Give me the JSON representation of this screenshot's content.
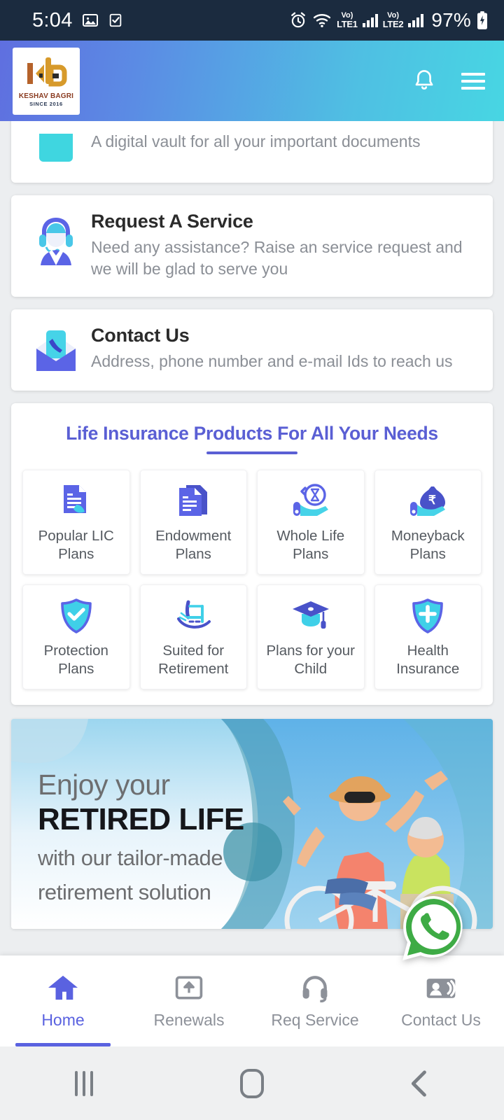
{
  "status_bar": {
    "time": "5:04",
    "battery_percent": "97%",
    "icons": [
      "image-icon",
      "checkbox-icon",
      "alarm-icon",
      "wifi-icon",
      "volte-lte1-icon",
      "signal-lte1-icon",
      "volte-lte2-icon",
      "signal-lte2-icon",
      "battery-charging-icon"
    ],
    "network_labels": {
      "volte": "Vo)",
      "sim1": "LTE1",
      "sim2": "LTE2"
    },
    "background": "#1b2b3f"
  },
  "app_bar": {
    "logo": {
      "name": "KESHAV BAGRI",
      "since": "SINCE 2016"
    },
    "notification_icon": "bell-icon",
    "menu_icon": "hamburger-menu-icon",
    "gradient_from": "#5f6fe0",
    "gradient_to": "#47d6e3"
  },
  "cards": [
    {
      "icon": "digital-vault-icon",
      "title": "",
      "desc": "A digital vault for all your important documents"
    },
    {
      "icon": "support-agent-icon",
      "title": "Request A Service",
      "desc": "Need any assistance? Raise an service request and we will be glad to serve you"
    },
    {
      "icon": "contact-envelope-icon",
      "title": "Contact Us",
      "desc": "Address, phone number and e-mail Ids to reach us"
    }
  ],
  "products": {
    "heading": "Life Insurance Products For All Your Needs",
    "accent_color": "#5a5fd4",
    "tiles": [
      {
        "icon": "document-star-icon",
        "label": "Popular LIC Plans"
      },
      {
        "icon": "documents-stack-icon",
        "label": "Endowment Plans"
      },
      {
        "icon": "hourglass-hand-icon",
        "label": "Whole Life Plans"
      },
      {
        "icon": "money-bag-hand-icon",
        "label": "Moneyback Plans"
      },
      {
        "icon": "shield-check-icon",
        "label": "Protection Plans"
      },
      {
        "icon": "rocking-chair-icon",
        "label": "Suited for Retirement"
      },
      {
        "icon": "graduation-cap-icon",
        "label": "Plans for your Child"
      },
      {
        "icon": "shield-plus-icon",
        "label": "Health Insurance"
      }
    ]
  },
  "banner": {
    "line1": "Enjoy your",
    "line2": "RETIRED LIFE",
    "line3": "with our tailor-made",
    "line4": "retirement solution",
    "image": "senior-couple-on-bicycle-photo"
  },
  "floating_action": {
    "icon": "whatsapp-icon",
    "color": "#3eab45"
  },
  "bottom_nav": {
    "active_color": "#5a62e0",
    "inactive_color": "#8d9199",
    "items": [
      {
        "icon": "home-icon",
        "label": "Home",
        "active": true
      },
      {
        "icon": "renewals-upload-icon",
        "label": "Renewals",
        "active": false
      },
      {
        "icon": "headset-icon",
        "label": "Req Service",
        "active": false
      },
      {
        "icon": "contact-card-icon",
        "label": "Contact Us",
        "active": false
      }
    ]
  },
  "android_nav": {
    "recents": "recents-icon",
    "home": "home-pill-icon",
    "back": "back-chevron-icon"
  }
}
